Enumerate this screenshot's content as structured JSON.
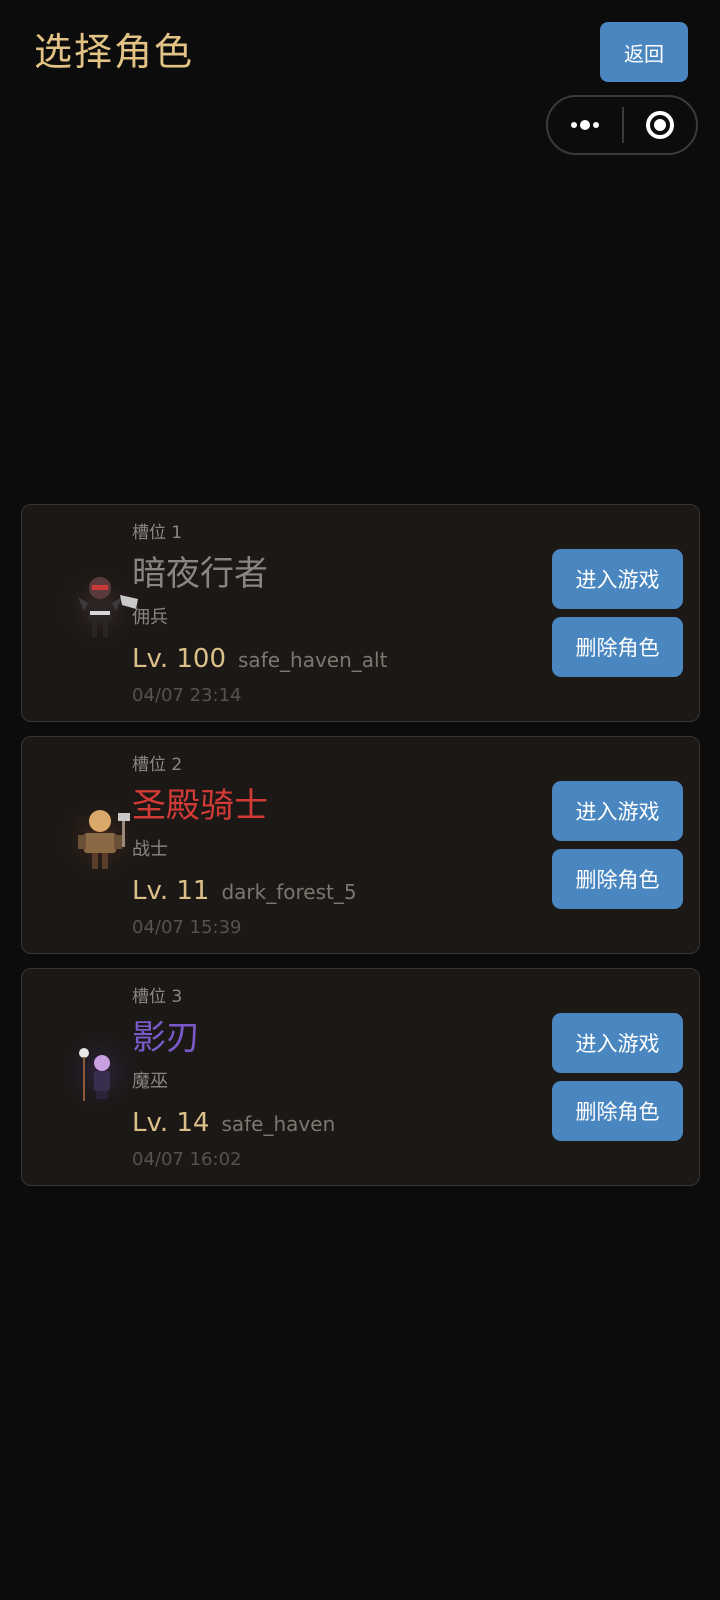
{
  "header": {
    "title": "选择角色",
    "back_label": "返回"
  },
  "capsule": {
    "more_icon": "more-dots-icon",
    "close_icon": "target-close-icon"
  },
  "characters": [
    {
      "slot": "槽位 1",
      "name": "暗夜行者",
      "name_color": "#8a8580",
      "class": "佣兵",
      "level": "Lv. 100",
      "location": "safe_haven_alt",
      "time": "04/07 23:14",
      "avatar_icon": "mercenary-avatar-icon",
      "enter_label": "进入游戏",
      "delete_label": "删除角色"
    },
    {
      "slot": "槽位 2",
      "name": "圣殿骑士",
      "name_color": "#d23a36",
      "class": "战士",
      "level": "Lv. 11",
      "location": "dark_forest_5",
      "time": "04/07 15:39",
      "avatar_icon": "warrior-avatar-icon",
      "enter_label": "进入游戏",
      "delete_label": "删除角色"
    },
    {
      "slot": "槽位 3",
      "name": "影刃",
      "name_color": "#7a5ac8",
      "class": "魔巫",
      "level": "Lv. 14",
      "location": "safe_haven",
      "time": "04/07 16:02",
      "avatar_icon": "mage-avatar-icon",
      "enter_label": "进入游戏",
      "delete_label": "删除角色"
    }
  ],
  "colors": {
    "background": "#0c0c0c",
    "accent_button": "#4a87c0",
    "title": "#e2c385",
    "level": "#dcc08a"
  }
}
